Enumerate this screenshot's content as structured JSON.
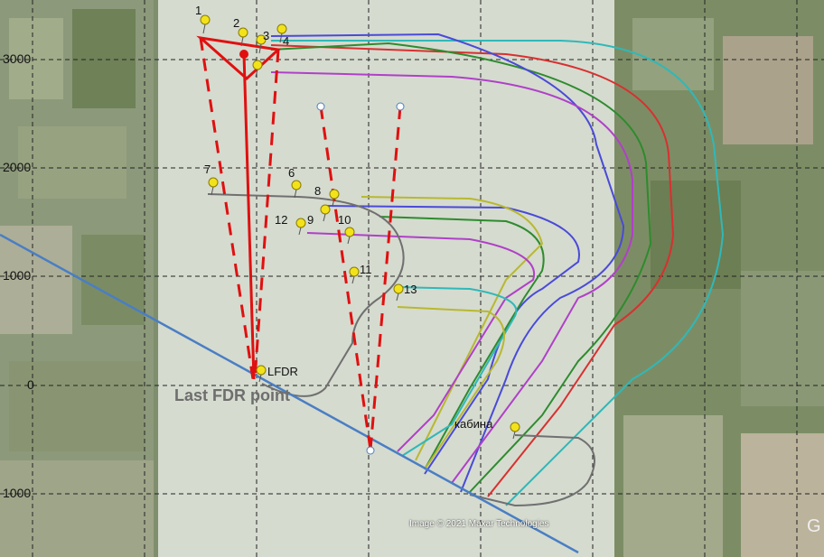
{
  "y_axis": {
    "ticks": [
      "3000",
      "2000",
      "1000",
      "0",
      "1000"
    ]
  },
  "pins": [
    {
      "label": "1"
    },
    {
      "label": "2"
    },
    {
      "label": "3"
    },
    {
      "label": "4"
    },
    {
      "label": "6"
    },
    {
      "label": "7"
    },
    {
      "label": "8"
    },
    {
      "label": "9"
    },
    {
      "label": "10"
    },
    {
      "label": "11"
    },
    {
      "label": "12"
    },
    {
      "label": "13"
    },
    {
      "label": "LFDR"
    },
    {
      "label": "кабина"
    }
  ],
  "annotations": {
    "last_fdr": "Last FDR point",
    "attribution": "Image © 2021 Maxar Technologies",
    "logo": "G"
  },
  "colors": {
    "red": "#e01010",
    "blue_line": "#4a7ec4",
    "tracks": [
      "#4a4ad8",
      "#2e8b2e",
      "#d83030",
      "#b040c8",
      "#30b8b8",
      "#b8b830",
      "#707070"
    ]
  }
}
